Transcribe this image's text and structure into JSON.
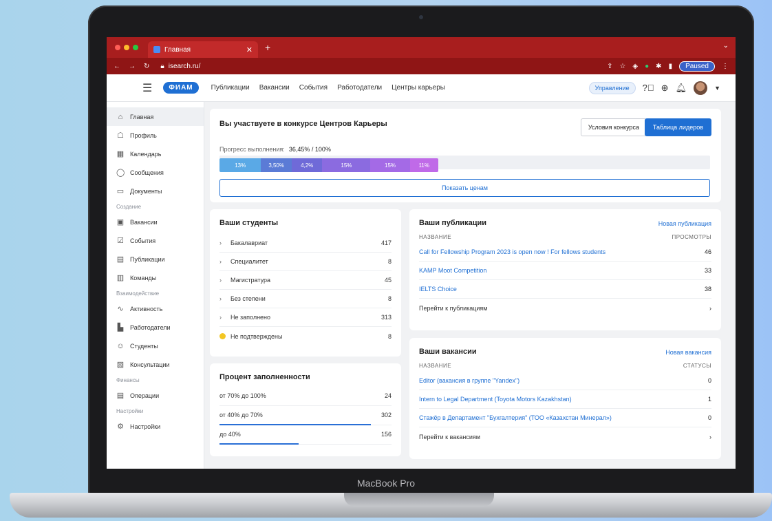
{
  "device": {
    "label": "MacBook Pro"
  },
  "browser": {
    "tab_title": "Главная",
    "url": "isearch.ru/",
    "profile_label": "Paused"
  },
  "header": {
    "logo": "ФИАМ",
    "nav": [
      "Публикации",
      "Вакансии",
      "События",
      "Работодатели",
      "Центры карьеры"
    ],
    "role": "Управление"
  },
  "sidebar": {
    "items_top": [
      {
        "label": "Главная",
        "icon": "home-icon"
      },
      {
        "label": "Профиль",
        "icon": "profile-icon"
      },
      {
        "label": "Календарь",
        "icon": "calendar-icon"
      },
      {
        "label": "Сообщения",
        "icon": "message-icon"
      },
      {
        "label": "Документы",
        "icon": "folder-icon"
      }
    ],
    "section_create": "Создание",
    "items_create": [
      {
        "label": "Вакансии",
        "icon": "briefcase-icon"
      },
      {
        "label": "События",
        "icon": "event-icon"
      },
      {
        "label": "Публикации",
        "icon": "publication-icon"
      },
      {
        "label": "Команды",
        "icon": "team-icon"
      }
    ],
    "section_interact": "Взаимодействие",
    "items_interact": [
      {
        "label": "Активность",
        "icon": "activity-icon"
      },
      {
        "label": "Работодатели",
        "icon": "employers-icon"
      },
      {
        "label": "Студенты",
        "icon": "students-icon"
      },
      {
        "label": "Консультации",
        "icon": "consult-icon"
      }
    ],
    "section_finance": "Финансы",
    "items_finance": [
      {
        "label": "Операции",
        "icon": "operations-icon"
      }
    ],
    "section_settings": "Настройки",
    "items_settings": [
      {
        "label": "Настройки",
        "icon": "settings-icon"
      }
    ]
  },
  "contest": {
    "title": "Вы участвуете в конкурсе Центров Карьеры",
    "btn_terms": "Условия конкурса",
    "btn_leaders": "Таблица лидеров",
    "progress_label": "Прогресс выполнения:",
    "progress_value": "36,45% / 100%",
    "segments": [
      {
        "label": "13%",
        "color": "#5aa9e6",
        "share": 0.19
      },
      {
        "label": "3,50%",
        "color": "#5b7bd6",
        "share": 0.14
      },
      {
        "label": "4,2%",
        "color": "#6f6ad8",
        "share": 0.14
      },
      {
        "label": "15%",
        "color": "#8b6be0",
        "share": 0.22
      },
      {
        "label": "15%",
        "color": "#a46ae6",
        "share": 0.18
      },
      {
        "label": "11%",
        "color": "#c06ae8",
        "share": 0.13
      }
    ],
    "show_prizes": "Показать ценам"
  },
  "students": {
    "title": "Ваши студенты",
    "rows": [
      {
        "label": "Бакалавриат",
        "value": "417"
      },
      {
        "label": "Специалитет",
        "value": "8"
      },
      {
        "label": "Магистратура",
        "value": "45"
      },
      {
        "label": "Без степени",
        "value": "8"
      },
      {
        "label": "Не заполнено",
        "value": "313"
      }
    ],
    "warning": {
      "label": "Не подтверждены",
      "value": "8"
    }
  },
  "fill": {
    "title": "Процент заполненности",
    "rows": [
      {
        "label": "от 70% до 100%",
        "value": "24",
        "level": 0
      },
      {
        "label": "от 40% до 70%",
        "value": "302",
        "level": 0.88
      },
      {
        "label": "до 40%",
        "value": "156",
        "level": 0.46
      }
    ]
  },
  "pubs": {
    "title": "Ваши публикации",
    "link": "Новая публикация",
    "col_name": "НАЗВАНИЕ",
    "col_value": "ПРОСМОТРЫ",
    "rows": [
      {
        "label": "Call for Fellowship Program 2023 is open now ! For fellows students",
        "value": "46"
      },
      {
        "label": "KAMP Moot Competition",
        "value": "33"
      },
      {
        "label": "IELTS Choice",
        "value": "38"
      }
    ],
    "goto": "Перейти к публикациям"
  },
  "vacancies": {
    "title": "Ваши вакансии",
    "link": "Новая вакансия",
    "col_name": "НАЗВАНИЕ",
    "col_value": "СТАТУСЫ",
    "rows": [
      {
        "label": "Editor (вакансия в группе \"Yandex\")",
        "value": "0"
      },
      {
        "label": "Intern to Legal Department (Toyota Motors Kazakhstan)",
        "value": "1"
      },
      {
        "label": "Стажёр в Департамент \"Бухгалтерия\" (ТОО «Казахстан Минерал»)",
        "value": "0"
      }
    ],
    "goto": "Перейти к вакансиям"
  }
}
